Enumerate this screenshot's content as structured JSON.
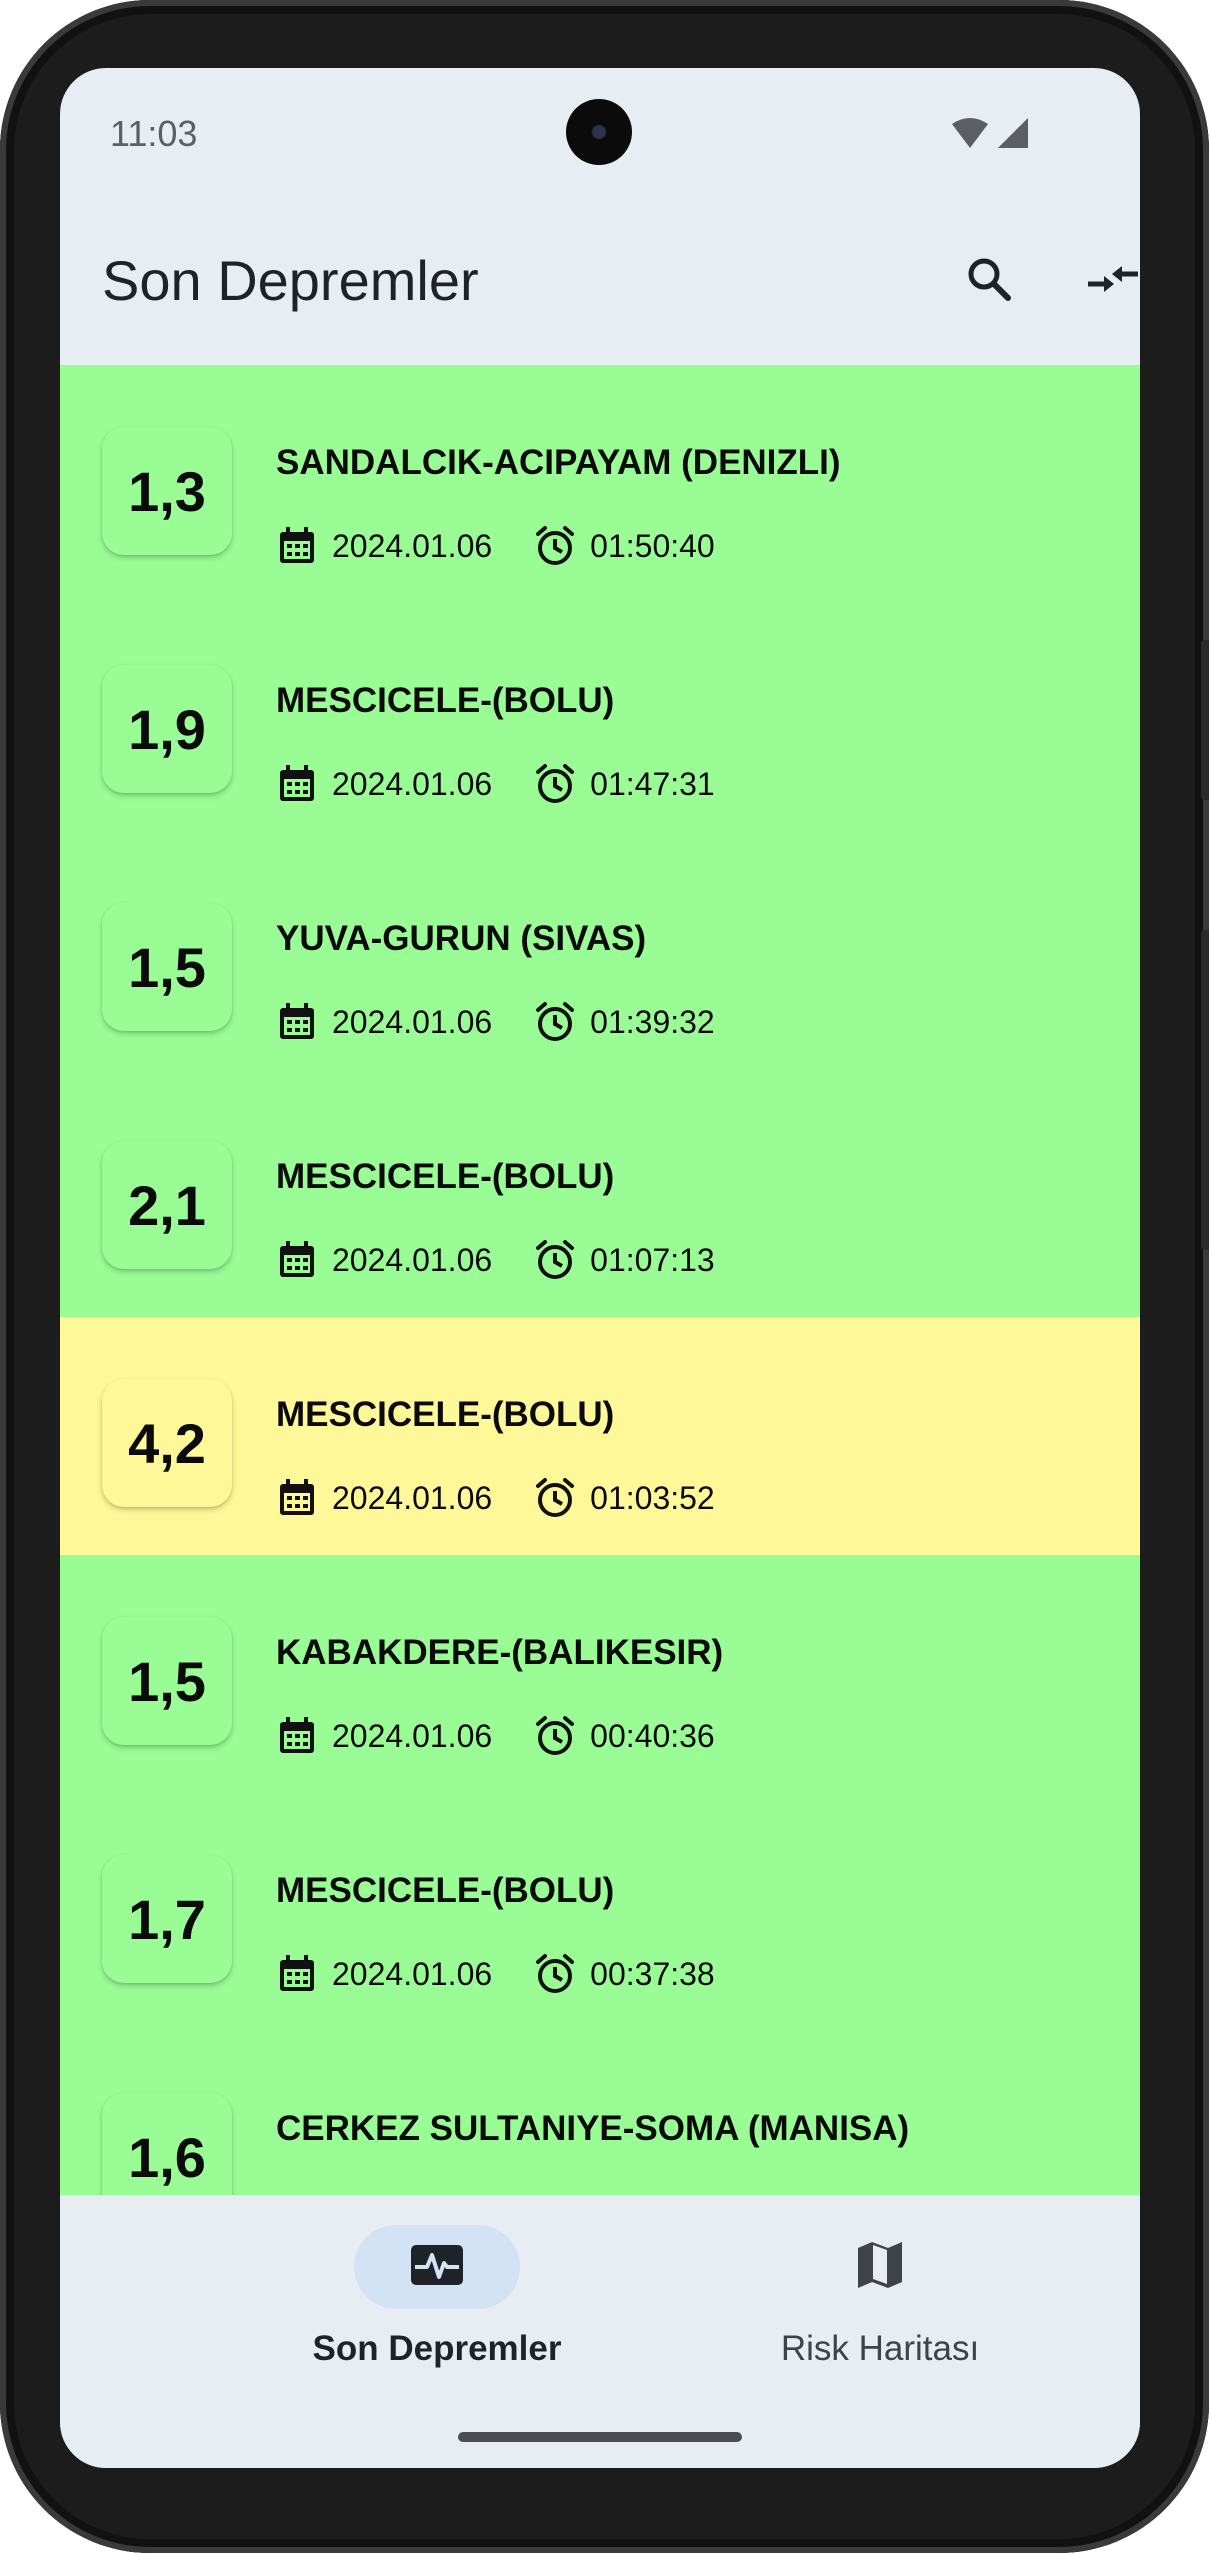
{
  "status_bar": {
    "time": "11:03"
  },
  "app_bar": {
    "title": "Son Depremler",
    "search_icon": "search-icon",
    "compress_icon": "compress-arrows-icon"
  },
  "colors": {
    "low": "#99fc95",
    "medium": "#fff899",
    "surface": "#e8edf4",
    "nav_active": "#d3e3f6"
  },
  "earthquakes": [
    {
      "magnitude": "1,3",
      "place": "SANDALCIK-ACIPAYAM (DENIZLI)",
      "date": "2024.01.06",
      "time": "01:50:40",
      "level": "low"
    },
    {
      "magnitude": "1,9",
      "place": "MESCICELE-(BOLU)",
      "date": "2024.01.06",
      "time": "01:47:31",
      "level": "low"
    },
    {
      "magnitude": "1,5",
      "place": "YUVA-GURUN (SIVAS)",
      "date": "2024.01.06",
      "time": "01:39:32",
      "level": "low"
    },
    {
      "magnitude": "2,1",
      "place": "MESCICELE-(BOLU)",
      "date": "2024.01.06",
      "time": "01:07:13",
      "level": "low"
    },
    {
      "magnitude": "4,2",
      "place": "MESCICELE-(BOLU)",
      "date": "2024.01.06",
      "time": "01:03:52",
      "level": "medium"
    },
    {
      "magnitude": "1,5",
      "place": "KABAKDERE-(BALIKESIR)",
      "date": "2024.01.06",
      "time": "00:40:36",
      "level": "low"
    },
    {
      "magnitude": "1,7",
      "place": "MESCICELE-(BOLU)",
      "date": "2024.01.06",
      "time": "00:37:38",
      "level": "low"
    },
    {
      "magnitude": "1,6",
      "place": "CERKEZ SULTANIYE-SOMA (MANISA)",
      "date": "",
      "time": "",
      "level": "low"
    }
  ],
  "bottom_nav": {
    "items": [
      {
        "label": "Son Depremler",
        "icon": "pulse-icon",
        "active": true
      },
      {
        "label": "Risk Haritası",
        "icon": "map-icon",
        "active": false
      }
    ]
  }
}
